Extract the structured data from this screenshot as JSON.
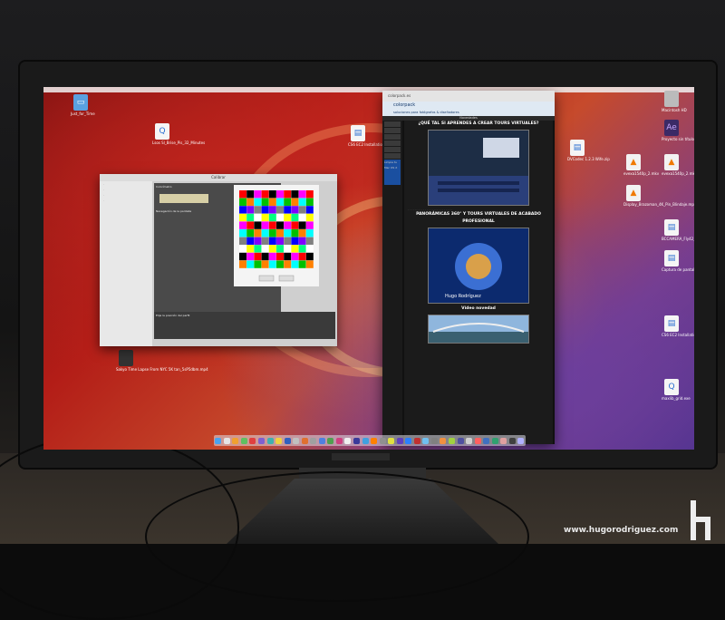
{
  "desktop": {
    "left_icons": [
      {
        "name": "just-for-time-folder",
        "label": "Just_for_Time",
        "type": "folder"
      },
      {
        "name": "doc-1",
        "label": "Lsos Sl_Brise_Pis_32_Minutes",
        "type": "doc"
      },
      {
        "name": "doc-2",
        "label": "CS6 EC2 Installation.dmg",
        "type": "doc"
      },
      {
        "name": "video-doc",
        "label": "Sakyo Time Lapse From NYC 5K tan_5sP5dbm.mp4",
        "type": "video"
      }
    ],
    "right_icons": [
      {
        "name": "hd-icon",
        "label": "Macintosh HD",
        "type": "drive"
      },
      {
        "name": "ae-icon",
        "label": "Proyecto sin título.aep",
        "type": "ae"
      },
      {
        "name": "vlc-1",
        "label": "evexa1540p_2.mkv",
        "type": "cone"
      },
      {
        "name": "vlc-2",
        "label": "evexa1540p_2.mkv",
        "type": "cone"
      },
      {
        "name": "doc-3",
        "label": "DVCodec 1.2.3 Wife.zip",
        "type": "doc"
      },
      {
        "name": "vlc-3",
        "label": "Display_Brazoman_4K_Pin_Blindaje.mp4",
        "type": "cone"
      },
      {
        "name": "doc-4",
        "label": "BCCAMERA_Fly42_29nl.mp4",
        "type": "doc"
      },
      {
        "name": "doc-5",
        "label": "Captura de pantalla 2014-06-16... 17.55.41.png",
        "type": "doc"
      },
      {
        "name": "doc-6",
        "label": "CS6 EC2 Installation.dmg",
        "type": "doc"
      },
      {
        "name": "doc-7",
        "label": "maxlib_grid.exe",
        "type": "doc"
      }
    ]
  },
  "color_window": {
    "title": "Calibrar",
    "panel_heading": "Colorímetro",
    "section_label": "Navegación de la pantalla",
    "button_back": "Atrás",
    "button_next": "Continuar",
    "bottom_label": "Elija la posición del perfil"
  },
  "browser": {
    "url": "colorpack.es",
    "site_name": "colorpack",
    "site_tagline": "soluciones para fotógrafos & diseñadores",
    "nav_label": "Novedades",
    "heading_1": "¿QUÉ TAL SI APRENDES A CREAR TOURS VIRTUALES?",
    "heading_2": "PANORÁMICAS 360° Y TOURS VIRTUALES DE ACABADO PROFESIONAL",
    "news_label": "Vídeo novedad",
    "photo_credit": "Hugo Rodríguez",
    "promo": "Limpia tu Mac OS X"
  },
  "watermark": "www.hugorodriguez.com",
  "colors": {
    "accent": "#2a6fd1",
    "wallpaper_red": "#b31d17",
    "wallpaper_purple": "#6b3f9e"
  }
}
